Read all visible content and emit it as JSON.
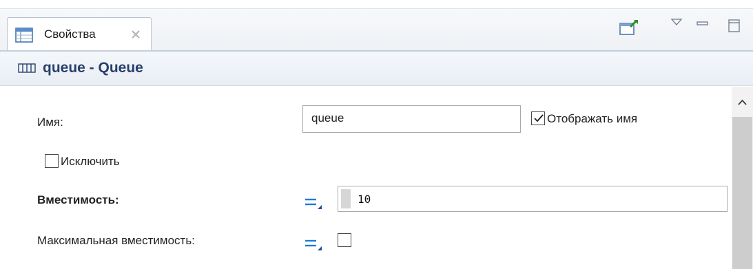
{
  "view": {
    "tab_label": "Свойства",
    "icons": {
      "tab": "properties-table-icon",
      "close": "close-icon",
      "pin": "pin-editor-icon",
      "menu": "view-menu-icon",
      "minimize": "minimize-icon",
      "maximize": "maximize-icon"
    }
  },
  "title": {
    "text": "queue - Queue",
    "icon": "queue-block-icon"
  },
  "properties": {
    "name_label": "Имя:",
    "name_value": "queue",
    "show_name_label": "Отображать имя",
    "show_name_checked": true,
    "exclude_label": "Исключить",
    "exclude_checked": false,
    "capacity_label": "Вместимость:",
    "capacity_value": "10",
    "max_capacity_label": "Максимальная вместимость:",
    "max_capacity_checked": false
  },
  "colors": {
    "title_text": "#283f6a",
    "expression_icon": "#1e7bd8"
  }
}
